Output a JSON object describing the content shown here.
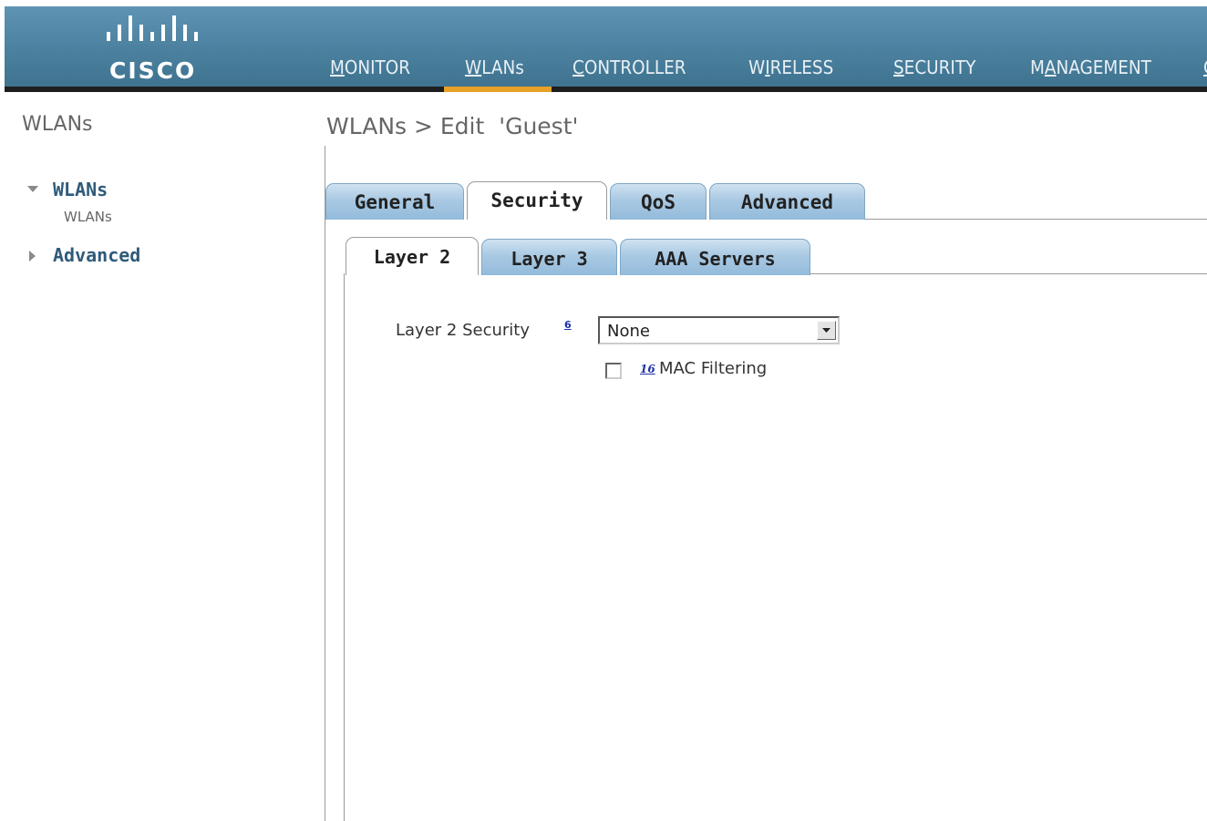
{
  "brand": {
    "name": "CISCO"
  },
  "nav": {
    "items": [
      {
        "pre": "",
        "ul": "M",
        "post": "ONITOR"
      },
      {
        "pre": "",
        "ul": "W",
        "post": "LANs"
      },
      {
        "pre": "",
        "ul": "C",
        "post": "ONTROLLER"
      },
      {
        "pre": "W",
        "ul": "I",
        "post": "RELESS"
      },
      {
        "pre": "",
        "ul": "S",
        "post": "ECURITY"
      },
      {
        "pre": "M",
        "ul": "A",
        "post": "NAGEMENT"
      },
      {
        "pre": "",
        "ul": "C",
        "post": ""
      }
    ],
    "active": "WLANs"
  },
  "sidebar": {
    "title": "WLANs",
    "items": [
      {
        "label": "WLANs",
        "sub": "WLANs"
      },
      {
        "label": "Advanced"
      }
    ]
  },
  "page": {
    "title": "WLANs > Edit  'Guest'"
  },
  "tabs": [
    "General",
    "Security",
    "QoS",
    "Advanced"
  ],
  "subtabs": [
    "Layer 2",
    "Layer 3",
    "AAA Servers"
  ],
  "form": {
    "layer2_security_label": "Layer 2 Security",
    "layer2_security_help": "6",
    "layer2_security_value": "None",
    "mac_filter_help": "16",
    "mac_filter_label": "MAC Filtering"
  },
  "colors": {
    "header": "#4b819f",
    "active_underline": "#e7a127",
    "tab_blue": "#a9c9e3",
    "link": "#1c2fa8"
  }
}
